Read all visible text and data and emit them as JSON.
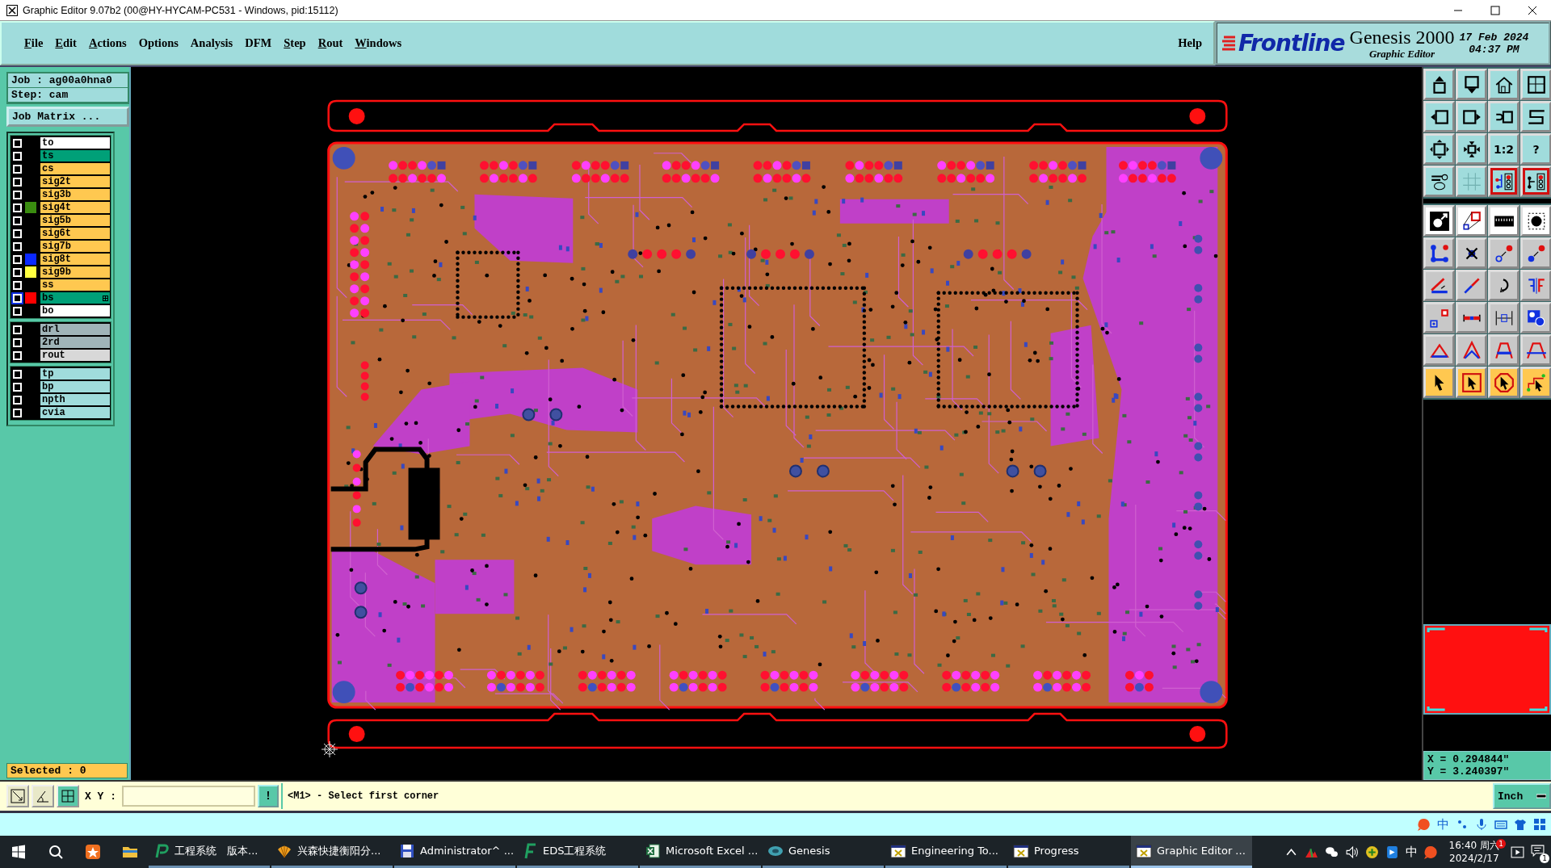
{
  "window": {
    "title": "Graphic Editor 9.07b2 (00@HY-HYCAM-PC531 - Windows, pid:15112)"
  },
  "menu": [
    {
      "label": "File",
      "mnemonic": true
    },
    {
      "label": "Edit",
      "mnemonic": true
    },
    {
      "label": "Actions",
      "mnemonic": true
    },
    {
      "label": "Options",
      "mnemonic": false
    },
    {
      "label": "Analysis",
      "mnemonic": false
    },
    {
      "label": "DFM",
      "mnemonic": false
    },
    {
      "label": "Step",
      "mnemonic": true
    },
    {
      "label": "Rout",
      "mnemonic": true
    },
    {
      "label": "Windows",
      "mnemonic": true
    }
  ],
  "help_menu": {
    "label": "Help"
  },
  "banner": {
    "brand": "Frontline",
    "product": "Genesis 2000",
    "subtitle": "Graphic Editor",
    "date": "17 Feb 2024",
    "time": "04:37 PM"
  },
  "job": {
    "job": "Job : ag00a0hna0",
    "step": "Step: cam",
    "matrix_button": "Job Matrix ..."
  },
  "layer_groups": [
    [
      {
        "name": "to",
        "kind": "overlay",
        "checked": false,
        "selected": false
      },
      {
        "name": "ts",
        "kind": "mask",
        "checked": false,
        "selected": false
      },
      {
        "name": "cs",
        "kind": "signal",
        "checked": false,
        "selected": false
      },
      {
        "name": "sig2t",
        "kind": "signal",
        "checked": false,
        "selected": false
      },
      {
        "name": "sig3b",
        "kind": "signal",
        "checked": false,
        "selected": false
      },
      {
        "name": "sig4t",
        "kind": "signal",
        "checked": false,
        "selected": false,
        "color": "#3a8c10"
      },
      {
        "name": "sig5b",
        "kind": "signal",
        "checked": false,
        "selected": false
      },
      {
        "name": "sig6t",
        "kind": "signal",
        "checked": false,
        "selected": false
      },
      {
        "name": "sig7b",
        "kind": "signal",
        "checked": false,
        "selected": false
      },
      {
        "name": "sig8t",
        "kind": "signal",
        "checked": false,
        "selected": false,
        "color": "#0a28ff"
      },
      {
        "name": "sig9b",
        "kind": "signal",
        "checked": false,
        "selected": false,
        "color": "#ffff40"
      },
      {
        "name": "ss",
        "kind": "signal",
        "checked": false,
        "selected": false
      },
      {
        "name": "bs",
        "kind": "mask",
        "checked": false,
        "selected": true,
        "color": "#ff0000"
      },
      {
        "name": "bo",
        "kind": "overlay",
        "checked": false,
        "selected": false
      }
    ],
    [
      {
        "name": "drl",
        "kind": "drill",
        "checked": false,
        "selected": false
      },
      {
        "name": "2rd",
        "kind": "drill",
        "checked": false,
        "selected": false
      },
      {
        "name": "rout",
        "kind": "rout",
        "checked": false,
        "selected": false
      }
    ],
    [
      {
        "name": "tp",
        "kind": "paste",
        "checked": false,
        "selected": false
      },
      {
        "name": "bp",
        "kind": "paste",
        "checked": false,
        "selected": false
      },
      {
        "name": "npth",
        "kind": "paste",
        "checked": false,
        "selected": false
      },
      {
        "name": "cvia",
        "kind": "paste",
        "checked": false,
        "selected": false
      }
    ]
  ],
  "selected_count": "Selected : 0",
  "toolbar": [
    [
      {
        "kind": "view",
        "on": false
      },
      {
        "kind": "view",
        "on": false
      },
      {
        "kind": "view",
        "on": false
      },
      {
        "kind": "view",
        "on": false
      },
      {
        "kind": "view",
        "on": false
      },
      {
        "kind": "view",
        "on": false
      },
      {
        "kind": "view",
        "on": false
      },
      {
        "kind": "view",
        "on": false
      },
      {
        "kind": "view",
        "on": false
      },
      {
        "kind": "view",
        "on": false
      },
      {
        "kind": "view",
        "on": false,
        "label": "1:2"
      },
      {
        "kind": "view",
        "on": false,
        "label": "?"
      },
      {
        "kind": "view",
        "on": false
      },
      {
        "kind": "view",
        "on": false
      },
      {
        "kind": "view",
        "on": true
      },
      {
        "kind": "view",
        "on": true
      }
    ],
    [
      {
        "kind": "display",
        "on": false
      },
      {
        "kind": "display",
        "on": false
      },
      {
        "kind": "display",
        "on": false
      },
      {
        "kind": "display",
        "on": false
      },
      {
        "kind": "edit",
        "on": false
      },
      {
        "kind": "edit",
        "on": false
      },
      {
        "kind": "edit",
        "on": false
      },
      {
        "kind": "edit",
        "on": false
      },
      {
        "kind": "edit",
        "on": false
      },
      {
        "kind": "edit",
        "on": false
      },
      {
        "kind": "edit",
        "on": false
      },
      {
        "kind": "edit",
        "on": false
      },
      {
        "kind": "edit",
        "on": false
      },
      {
        "kind": "edit",
        "on": false
      },
      {
        "kind": "edit",
        "on": false
      },
      {
        "kind": "edit",
        "on": false
      },
      {
        "kind": "edit",
        "on": false
      },
      {
        "kind": "edit",
        "on": false
      },
      {
        "kind": "edit",
        "on": false
      },
      {
        "kind": "edit",
        "on": false
      },
      {
        "kind": "select",
        "on": false
      },
      {
        "kind": "select",
        "on": false
      },
      {
        "kind": "select",
        "on": false
      },
      {
        "kind": "select",
        "on": false
      }
    ]
  ],
  "coordinates": {
    "x": "X = 0.294844\"",
    "y": "Y = 3.240397\""
  },
  "command_bar": {
    "xy_label": "X Y :",
    "exec_button": "!",
    "prompt": "<M1> - Select first corner",
    "units": "Inch"
  },
  "ime_bar": {
    "mode": "中"
  },
  "taskbar": {
    "items": [
      {
        "label": "工程系统　版本...",
        "kind": "p-app",
        "selected": false
      },
      {
        "label": "兴森快捷衡阳分...",
        "kind": "shell",
        "selected": false
      },
      {
        "label": "Administrator^ ...",
        "kind": "disk",
        "selected": false
      },
      {
        "label": "EDS工程系统",
        "kind": "f-app",
        "selected": false
      },
      {
        "label": "Microsoft Excel ...",
        "kind": "sheet",
        "selected": false
      },
      {
        "label": "Genesis",
        "kind": "genesis",
        "selected": false
      },
      {
        "label": "Engineering To...",
        "kind": "window",
        "selected": false
      },
      {
        "label": "Progress",
        "kind": "window",
        "selected": false
      },
      {
        "label": "Graphic Editor ...",
        "kind": "window",
        "selected": true
      }
    ],
    "tray_ime": "中",
    "time": "16:40 周六",
    "date": "2024/2/17",
    "clock_badge": "1",
    "notification_badge": "1"
  }
}
